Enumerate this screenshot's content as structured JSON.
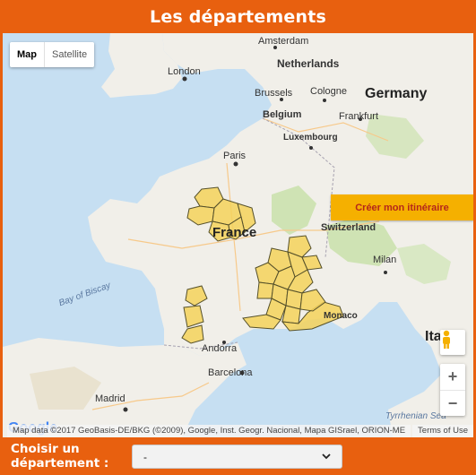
{
  "page": {
    "title": "Les départements"
  },
  "map": {
    "type_map": "Map",
    "type_satellite": "Satellite",
    "itinerary_button": "Créer mon itinéraire",
    "attribution": "Map data ©2017 GeoBasis-DE/BKG (©2009), Google, Inst. Geogr. Nacional, Mapa GISrael, ORION-ME",
    "terms": "Terms of Use",
    "google_logo": "Google",
    "labels": {
      "amsterdam": "Amsterdam",
      "netherlands": "Netherlands",
      "london": "London",
      "germany": "Germany",
      "brussels": "Brussels",
      "cologne": "Cologne",
      "belgium": "Belgium",
      "frankfurt": "Frankfurt",
      "luxembourg": "Luxembourg",
      "paris": "Paris",
      "france": "France",
      "switzerland": "Switzerland",
      "milan": "Milan",
      "bay_of_biscay": "Bay of Biscay",
      "monaco": "Monaco",
      "andorra": "Andorra",
      "barcelona": "Barcelona",
      "madrid": "Madrid",
      "tyrrhenian": "Tyrrhenian Sea",
      "italy": "Ital"
    }
  },
  "footer": {
    "label": "Choisir un département :",
    "select_value": "-"
  },
  "colors": {
    "header_bg": "#e8600f",
    "department_fill": "#f5d25a",
    "department_stroke": "#55502a",
    "itinerary_bg": "#f5b000"
  }
}
